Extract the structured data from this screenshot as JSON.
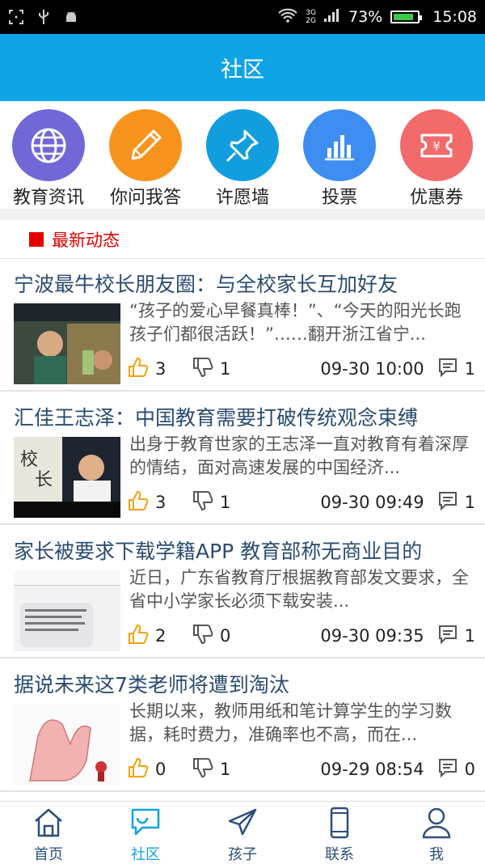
{
  "status_bar": {
    "signal_top": "3G",
    "signal_bottom": "2G",
    "battery_percent": "73%",
    "time": "15:08",
    "battery_level": 0.73
  },
  "header": {
    "title": "社区"
  },
  "quick_actions": [
    {
      "label": "教育资讯",
      "icon": "globe-icon",
      "color": "#7068d6"
    },
    {
      "label": "你问我答",
      "icon": "pencil-icon",
      "color": "#f7941d"
    },
    {
      "label": "许愿墙",
      "icon": "pushpin-icon",
      "color": "#129dde"
    },
    {
      "label": "投票",
      "icon": "bar-chart-icon",
      "color": "#3d8ef0"
    },
    {
      "label": "优惠券",
      "icon": "coupon-icon",
      "color": "#f26a6a"
    }
  ],
  "section": {
    "title": "最新动态"
  },
  "news": [
    {
      "title": "宁波最牛校长朋友圈：与全校家长互加好友",
      "summary": "“孩子的爱心早餐真棒！”、“今天的阳光长跑孩子们都很活跃！”……翻开浙江省宁...",
      "likes": "3",
      "dislikes": "1",
      "time": "09-30 10:00",
      "comments": "1"
    },
    {
      "title": "汇佳王志泽：中国教育需要打破传统观念束缚",
      "summary": "出身于教育世家的王志泽一直对教育有着深厚的情结，面对高速发展的中国经济...",
      "likes": "3",
      "dislikes": "1",
      "time": "09-30 09:49",
      "comments": "1"
    },
    {
      "title": "家长被要求下载学籍APP 教育部称无商业目的",
      "summary": "近日，广东省教育厅根据教育部发文要求，全省中小学家长必须下载安装...",
      "likes": "2",
      "dislikes": "0",
      "time": "09-30 09:35",
      "comments": "1"
    },
    {
      "title": "据说未来这7类老师将遭到淘汰",
      "summary": "长期以来，教师用纸和笔计算学生的学习数据，耗时费力，准确率也不高，而在...",
      "likes": "0",
      "dislikes": "1",
      "time": "09-29 08:54",
      "comments": "0"
    }
  ],
  "tabs": [
    {
      "label": "首页",
      "icon": "home-icon"
    },
    {
      "label": "社区",
      "icon": "chat-icon"
    },
    {
      "label": "孩子",
      "icon": "paper-plane-icon"
    },
    {
      "label": "联系",
      "icon": "phone-icon"
    },
    {
      "label": "我",
      "icon": "user-icon"
    }
  ]
}
